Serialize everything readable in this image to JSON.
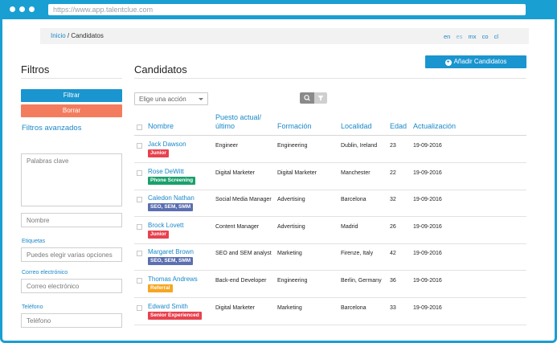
{
  "browser": {
    "url": "https://www.app.talentclue.com"
  },
  "breadcrumb": {
    "home": "Inicio",
    "sep": " / ",
    "current": "Candidatos"
  },
  "languages": [
    "en",
    "es",
    "mx",
    "co",
    "cl"
  ],
  "sidebar": {
    "title": "Filtros",
    "filter_label": "Filtrar",
    "clear_label": "Borrar",
    "advanced_label": "Filtros avanzados",
    "keywords_placeholder": "Palabras clave",
    "name_placeholder": "Nombre",
    "tags_label": "Etiquetas",
    "tags_placeholder": "Puedes elegir varias opciones",
    "email_label": "Correo electrónico",
    "email_placeholder": "Correo electrónico",
    "phone_label": "Teléfono",
    "phone_placeholder": "Teléfono"
  },
  "main": {
    "title": "Candidatos",
    "add_label": "Añadir Candidatos",
    "action_select": "Elige una acción",
    "columns": {
      "name": "Nombre",
      "position": "Puesto actual/ último",
      "education": "Formación",
      "location": "Localidad",
      "age": "Edad",
      "updated": "Actualización"
    },
    "rows": [
      {
        "name": "Jack Dawson",
        "badge": "Junior",
        "badge_color": "#e8414e",
        "position": "Engineer",
        "education": "Engineering",
        "location": "Dublin, Ireland",
        "age": "23",
        "updated": "19-09-2016"
      },
      {
        "name": "Rose DeWitt",
        "badge": "Phone Screening",
        "badge_color": "#1aa06d",
        "position": "Digital Marketer",
        "education": "Digital Marketer",
        "location": "Manchester",
        "age": "22",
        "updated": "19-09-2016"
      },
      {
        "name": "Caledon Nathan",
        "badge": "SEO, SEM, SMM",
        "badge_color": "#5b6fb1",
        "position": "Social Media Manager",
        "education": "Advertising",
        "location": "Barcelona",
        "age": "32",
        "updated": "19-09-2016"
      },
      {
        "name": "Brock Lovett",
        "badge": "Junior",
        "badge_color": "#e8414e",
        "position": "Content Manager",
        "education": "Advertising",
        "location": "Madrid",
        "age": "26",
        "updated": "19-09-2016"
      },
      {
        "name": "Margaret Brown",
        "badge": "SEO, SEM, SMM",
        "badge_color": "#5b6fb1",
        "position": "SEO and SEM analyst",
        "education": "Marketing",
        "location": "Firenze, Italy",
        "age": "42",
        "updated": "19-09-2016"
      },
      {
        "name": "Thomas Andrews",
        "badge": "Referral",
        "badge_color": "#f5a623",
        "position": "Back-end Developer",
        "education": "Engineering",
        "location": "Berlin, Germany",
        "age": "36",
        "updated": "19-09-2016"
      },
      {
        "name": "Edward Smith",
        "badge": "Senior Experienced",
        "badge_color": "#e8414e",
        "position": "Digital Marketer",
        "education": "Marketing",
        "location": "Barcelona",
        "age": "33",
        "updated": "19-09-2016"
      }
    ]
  },
  "icons": {
    "search": "search-icon",
    "filter": "filter-icon",
    "add": "plus-circle-icon"
  }
}
